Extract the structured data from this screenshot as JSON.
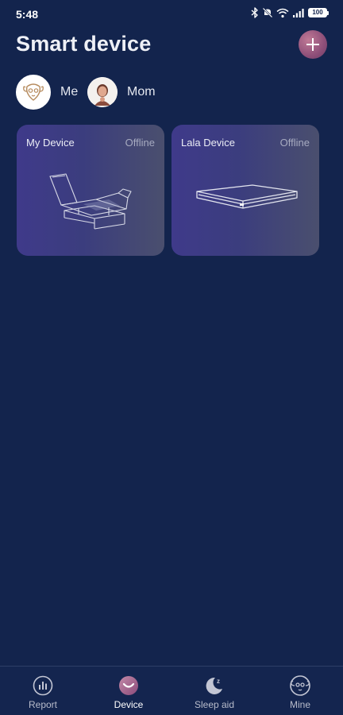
{
  "status_bar": {
    "time": "5:48",
    "battery": "100",
    "icons": [
      "bluetooth-icon",
      "mute-icon",
      "wifi-icon",
      "signal-icon",
      "battery-icon"
    ]
  },
  "header": {
    "title": "Smart device",
    "add_icon": "plus-icon"
  },
  "members": [
    {
      "name": "Me",
      "avatar": "sheep-logo-avatar",
      "selected": true
    },
    {
      "name": "Mom",
      "avatar": "person-photo-avatar",
      "selected": false
    }
  ],
  "devices": [
    {
      "name": "My Device",
      "status": "Offline",
      "image": "adjustable-bed-outline"
    },
    {
      "name": "Lala Device",
      "status": "Offline",
      "image": "mattress-outline"
    }
  ],
  "nav": [
    {
      "label": "Report",
      "icon": "bar-chart-circle-icon",
      "active": false
    },
    {
      "label": "Device",
      "icon": "device-smile-icon",
      "active": true
    },
    {
      "label": "Sleep aid",
      "icon": "moon-z-icon",
      "active": false
    },
    {
      "label": "Mine",
      "icon": "sheep-face-icon",
      "active": false
    }
  ],
  "colors": {
    "background": "#13244d",
    "card_start": "#3f3a8a",
    "card_end": "#4a4f6e",
    "accent": "#8e4f79",
    "text_secondary": "#a7abc0"
  }
}
